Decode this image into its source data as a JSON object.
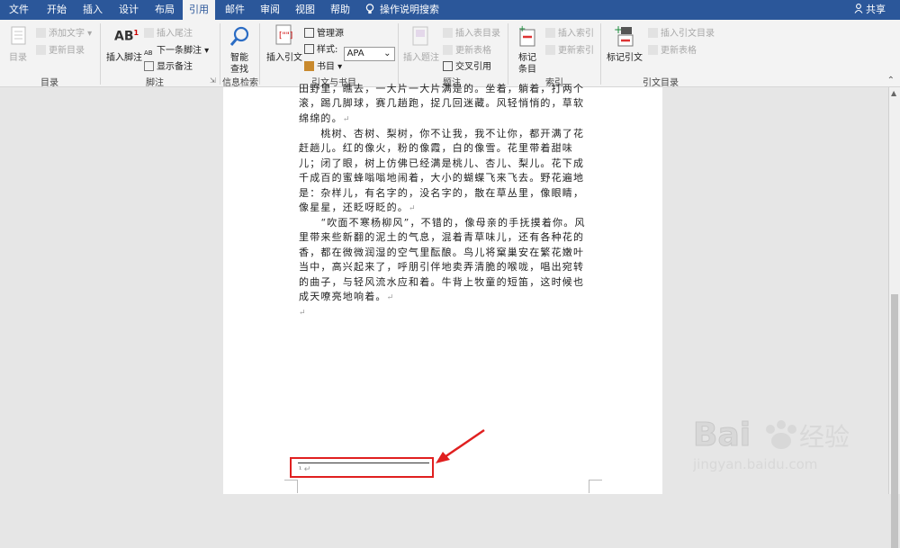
{
  "tabs": [
    {
      "label": "文件"
    },
    {
      "label": "开始"
    },
    {
      "label": "插入"
    },
    {
      "label": "设计"
    },
    {
      "label": "布局"
    },
    {
      "label": "引用",
      "active": true
    },
    {
      "label": "邮件"
    },
    {
      "label": "审阅"
    },
    {
      "label": "视图"
    },
    {
      "label": "帮助"
    }
  ],
  "tell_me": "操作说明搜索",
  "share": "共享",
  "ribbon": {
    "toc": {
      "big": "目录",
      "add_text": "添加文字",
      "update": "更新目录",
      "group": "目录"
    },
    "footnotes": {
      "insert_footnote": "插入脚注",
      "insert_endnote": "插入尾注",
      "next_footnote": "下一条脚注",
      "show_notes": "显示备注",
      "group": "脚注"
    },
    "research": {
      "smart_lookup_1": "智能",
      "smart_lookup_2": "查找",
      "group": "信息检索"
    },
    "citations": {
      "insert_citation": "插入引文",
      "manage_sources": "管理源",
      "style_label": "样式:",
      "style_value": "APA",
      "bibliography": "书目",
      "group": "引文与书目"
    },
    "captions": {
      "insert_caption": "插入题注",
      "insert_table_of_figures": "插入表目录",
      "update_table": "更新表格",
      "cross_reference": "交叉引用",
      "group": "题注"
    },
    "index": {
      "mark_entry_1": "标记",
      "mark_entry_2": "条目",
      "insert_index": "插入索引",
      "update_index": "更新索引",
      "group": "索引"
    },
    "authorities": {
      "mark_citation": "标记引文",
      "insert_toa": "插入引文目录",
      "update_table": "更新表格",
      "group": "引文目录"
    }
  },
  "document": {
    "paragraphs": [
      "田野里，瞧去，一大片一大片满是的。坐着，躺着，打两个滚，踢几脚球，赛几趟跑，捉几回迷藏。风轻悄悄的，草软绵绵的。",
      "　　桃树、杏树、梨树，你不让我，我不让你，都开满了花赶趟儿。红的像火，粉的像霞，白的像雪。花里带着甜味儿；闭了眼，树上仿佛已经满是桃儿、杏儿、梨儿。花下成千成百的蜜蜂嗡嗡地闹着，大小的蝴蝶飞来飞去。野花遍地是：杂样儿，有名字的，没名字的，散在草丛里，像眼睛，像星星，还眨呀眨的。",
      "　　“吹面不寒杨柳风”，不错的，像母亲的手抚摸着你。风里带来些新翻的泥土的气息，混着青草味儿，还有各种花的香，都在微微润湿的空气里酝酿。鸟儿将窠巢安在繁花嫩叶当中，高兴起来了，呼朋引伴地卖弄清脆的喉咙，唱出宛转的曲子，与轻风流水应和着。牛背上牧童的短笛，这时候也成天嘹亮地响着。"
    ],
    "paragraph_mark": "↵",
    "footnote_ref": "¹"
  },
  "watermark": {
    "brand": "Bai",
    "brand_suffix": "经验",
    "url": "jingyan.baidu.com"
  },
  "colors": {
    "tabbar": "#2b579a",
    "annotation_red": "#e02020"
  }
}
